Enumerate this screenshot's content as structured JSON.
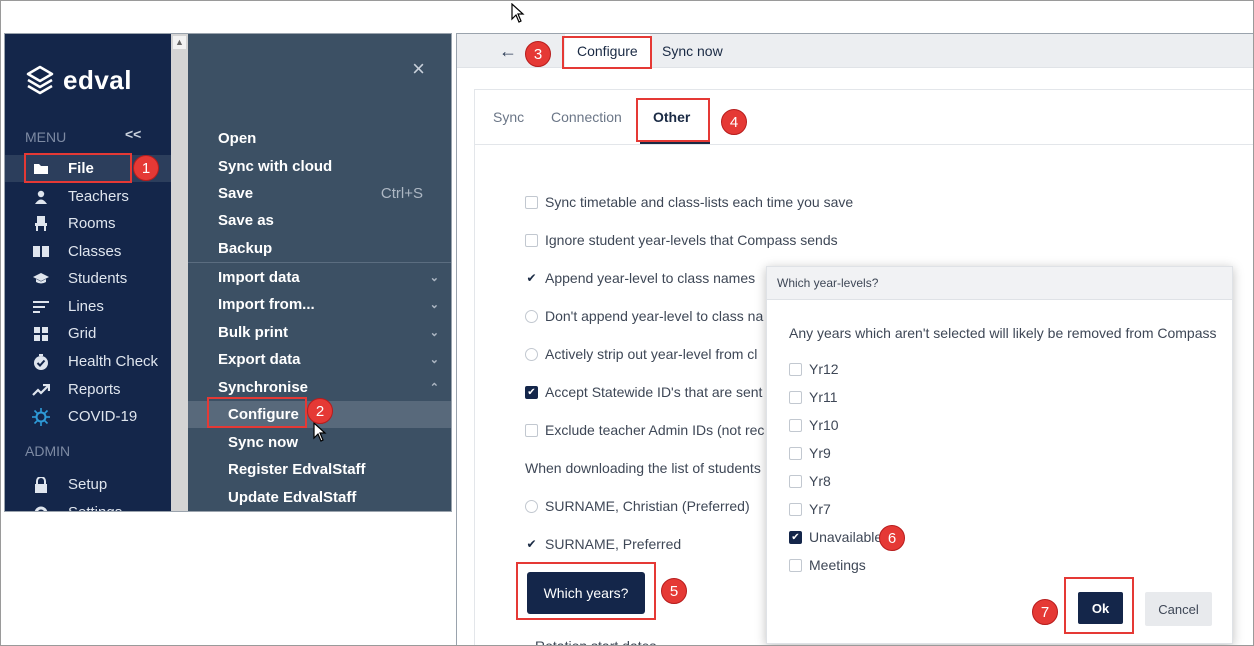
{
  "sidebar": {
    "brand": "edval",
    "menu_heading": "MENU",
    "collapse_glyph": "<<",
    "items": [
      {
        "label": "File",
        "icon": "folder-icon"
      },
      {
        "label": "Teachers",
        "icon": "person-icon"
      },
      {
        "label": "Rooms",
        "icon": "chair-icon"
      },
      {
        "label": "Classes",
        "icon": "book-icon"
      },
      {
        "label": "Students",
        "icon": "graduation-cap-icon"
      },
      {
        "label": "Lines",
        "icon": "lines-icon"
      },
      {
        "label": "Grid",
        "icon": "grid-icon"
      },
      {
        "label": "Health Check",
        "icon": "check-badge-icon"
      },
      {
        "label": "Reports",
        "icon": "trend-icon"
      },
      {
        "label": "COVID-19",
        "icon": "virus-icon"
      }
    ],
    "admin_heading": "ADMIN",
    "admin_items": [
      {
        "label": "Setup",
        "icon": "lock-icon"
      },
      {
        "label": "Settings",
        "icon": "gear-icon"
      }
    ]
  },
  "file_menu": {
    "close": "×",
    "items": [
      {
        "label": "Open"
      },
      {
        "label": "Sync with cloud"
      },
      {
        "label": "Save",
        "shortcut": "Ctrl+S"
      },
      {
        "label": "Save as"
      },
      {
        "label": "Backup"
      },
      {
        "label": "Import data"
      },
      {
        "label": "Import from..."
      },
      {
        "label": "Bulk print"
      },
      {
        "label": "Export data"
      },
      {
        "label": "Synchronise"
      }
    ],
    "sub_items": [
      {
        "label": "Configure"
      },
      {
        "label": "Sync now"
      },
      {
        "label": "Register EdvalStaff"
      },
      {
        "label": "Update EdvalStaff"
      }
    ]
  },
  "topbar": {
    "back": "←",
    "tabs": [
      "Configure",
      "Sync now"
    ]
  },
  "subtabs": [
    "Sync",
    "Connection",
    "Other"
  ],
  "options": [
    {
      "label": "Sync timetable and class-lists each time you save",
      "kind": "checkbox",
      "checked": false
    },
    {
      "label": "Ignore student year-levels that Compass sends",
      "kind": "checkbox",
      "checked": false
    },
    {
      "label": "Append year-level to class names",
      "kind": "radio",
      "checked": true
    },
    {
      "label": "Don't append year-level to class na",
      "kind": "radio",
      "checked": false
    },
    {
      "label": "Actively strip out year-level from cl",
      "kind": "radio",
      "checked": false
    },
    {
      "label": "Accept Statewide ID's that are sent",
      "kind": "checkbox",
      "checked": true
    },
    {
      "label": "Exclude teacher Admin IDs (not rec",
      "kind": "checkbox",
      "checked": false
    }
  ],
  "download_label": "When downloading the list of students",
  "name_options": [
    {
      "label": "SURNAME, Christian (Preferred)",
      "checked": false
    },
    {
      "label": "SURNAME, Preferred",
      "checked": true
    }
  ],
  "which_years_button": "Which years?",
  "rotation_label": "Rotation start dates",
  "dialog": {
    "title": "Which year-levels?",
    "note": "Any years which aren't selected will likely be removed from Compass",
    "options": [
      {
        "label": "Yr12",
        "checked": false
      },
      {
        "label": "Yr11",
        "checked": false
      },
      {
        "label": "Yr10",
        "checked": false
      },
      {
        "label": "Yr9",
        "checked": false
      },
      {
        "label": "Yr8",
        "checked": false
      },
      {
        "label": "Yr7",
        "checked": false
      },
      {
        "label": "Unavailable",
        "checked": true
      },
      {
        "label": "Meetings",
        "checked": false
      }
    ],
    "ok": "Ok",
    "cancel": "Cancel"
  },
  "steps": [
    "1",
    "2",
    "3",
    "4",
    "5",
    "6",
    "7"
  ],
  "colors": {
    "navy": "#14264a",
    "menu_bg": "#3c5064",
    "highlight": "#e53935"
  }
}
